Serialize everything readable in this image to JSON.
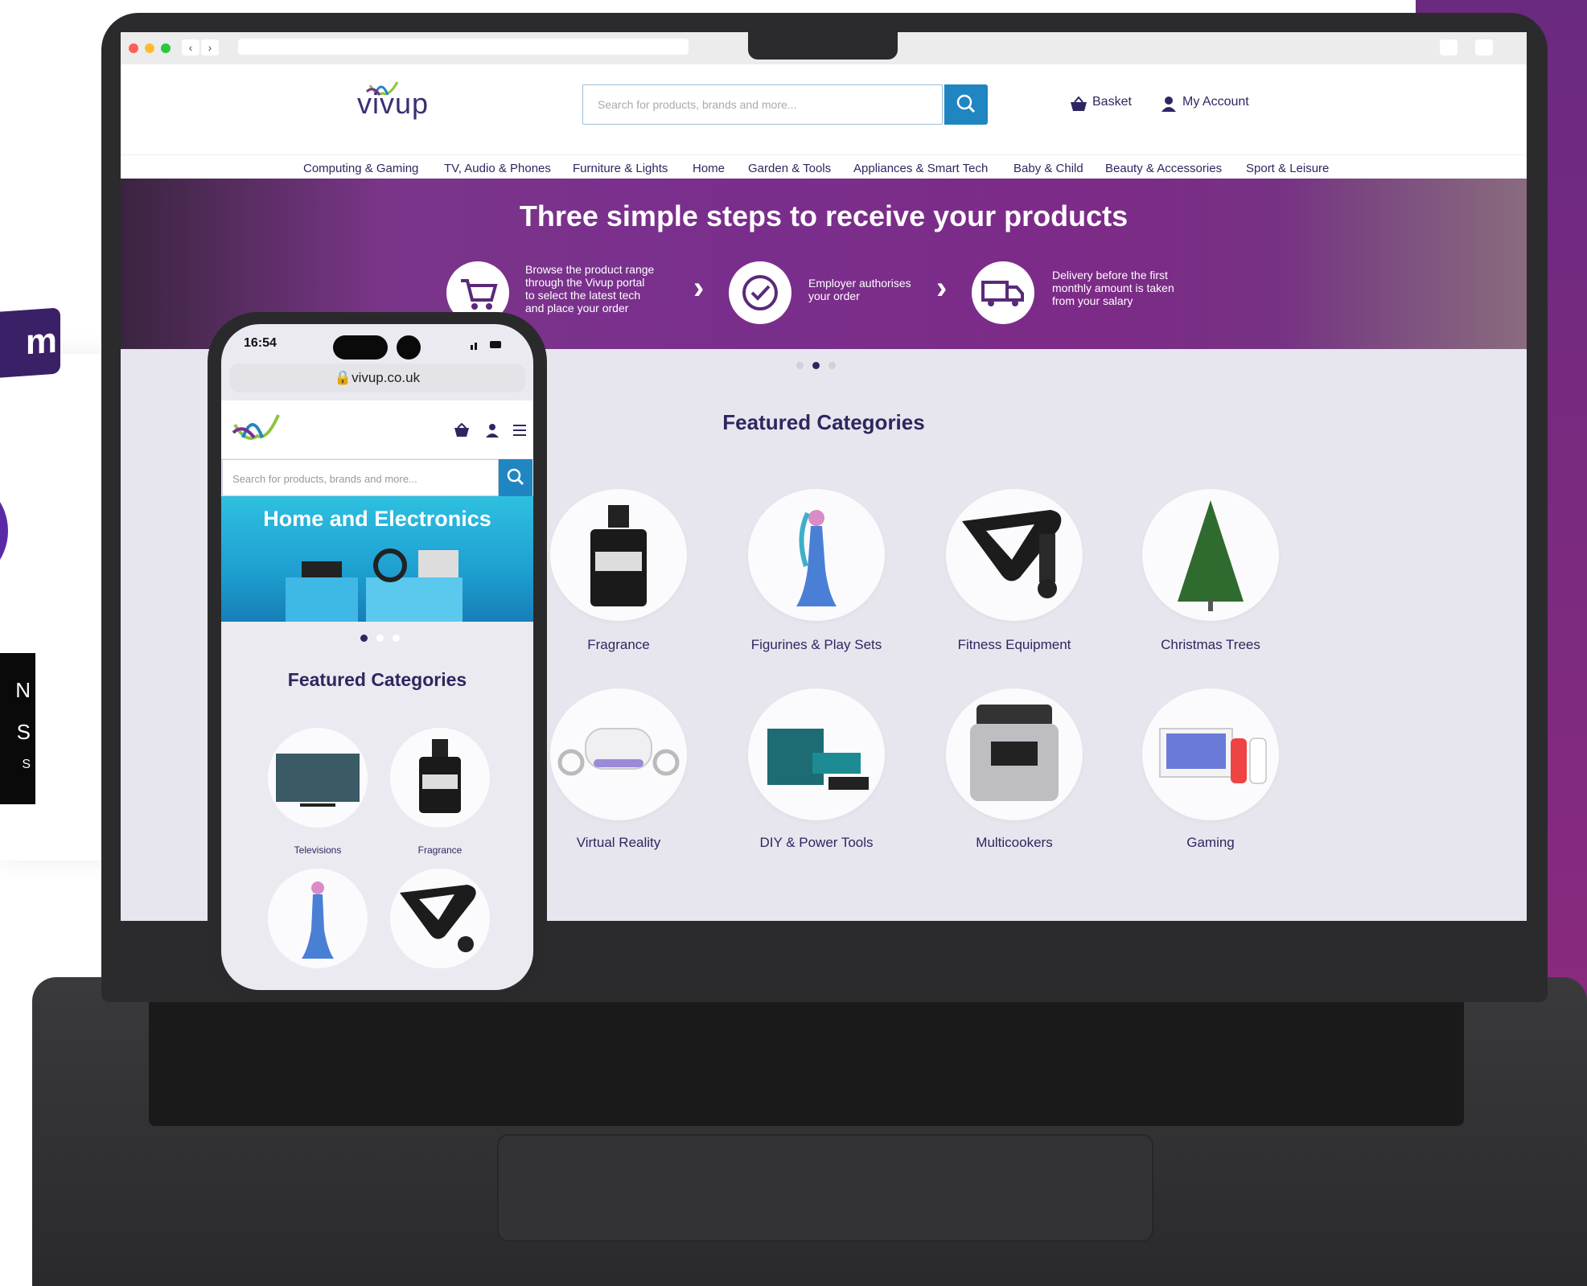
{
  "left_panel": {
    "tag_text": "m",
    "black_lines": [
      "N",
      "S",
      "S"
    ]
  },
  "site": {
    "logo": "vivup",
    "search_placeholder": "Search for products, brands and more...",
    "basket_label": "Basket",
    "account_label": "My Account",
    "nav": [
      "Computing & Gaming",
      "TV, Audio & Phones",
      "Furniture & Lights",
      "Home",
      "Garden & Tools",
      "Appliances & Smart Tech",
      "Baby & Child",
      "Beauty & Accessories",
      "Sport & Leisure"
    ],
    "hero": {
      "title": "Three simple steps to receive your products",
      "steps": [
        {
          "icon": "cart-icon",
          "lines": [
            "Browse the product range",
            "through  the Vivup portal",
            "to select the latest tech",
            "and place your order"
          ]
        },
        {
          "icon": "check-icon",
          "lines": [
            "Employer authorises",
            "your order"
          ]
        },
        {
          "icon": "truck-icon",
          "lines": [
            "Delivery before the first",
            "monthly amount is taken",
            "from your salary"
          ]
        }
      ]
    },
    "featured_title": "Featured Categories",
    "categories": [
      "Fragrance",
      "Figurines & Play Sets",
      "Fitness Equipment",
      "Christmas Trees",
      "Virtual Reality",
      "DIY & Power Tools",
      "Multicookers",
      "Gaming"
    ]
  },
  "phone": {
    "time": "16:54",
    "url": "vivup.co.uk",
    "search_placeholder": "Search for products, brands and more...",
    "banner_title": "Home and Electronics",
    "featured_title": "Featured Categories",
    "categories": [
      "Televisions",
      "Fragrance"
    ]
  },
  "colors": {
    "brand_purple": "#2d2760",
    "accent_blue": "#1f86c2",
    "hero_purple": "#7a2f8d"
  }
}
